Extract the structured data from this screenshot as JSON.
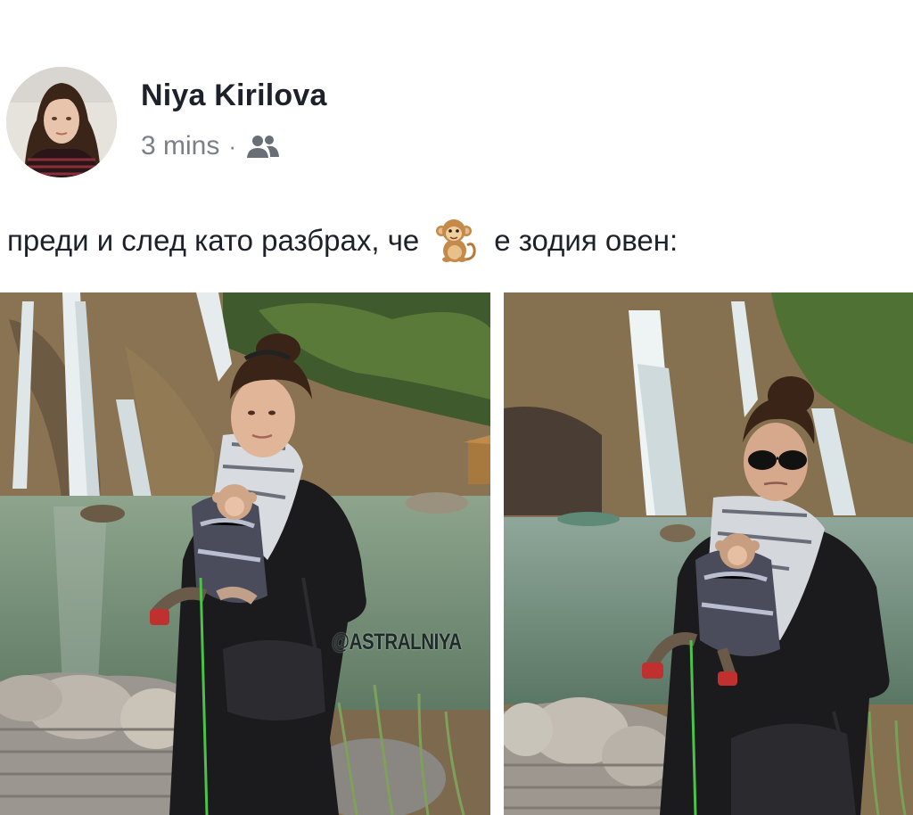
{
  "post": {
    "author_name": "Niya Kirilova",
    "timestamp": "3 mins",
    "separator": "·",
    "audience_icon": "friends-icon",
    "caption_before": "преди и след като разбрах, че",
    "caption_emoji": "monkey-emoji-icon",
    "caption_after": "е зодия овен:"
  },
  "photos": {
    "left": {
      "watermark": "@ASTRALNIYA"
    },
    "right": {}
  },
  "colors": {
    "name_text": "#1d2129",
    "meta_text": "#7b7f86",
    "background": "#ffffff"
  }
}
